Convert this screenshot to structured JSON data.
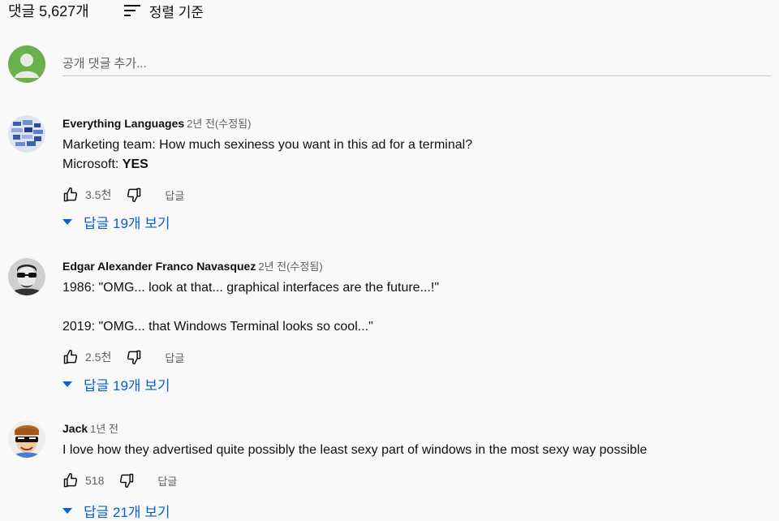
{
  "header": {
    "comment_count": "댓글 5,627개",
    "sort_label": "정렬 기준"
  },
  "add_comment": {
    "placeholder": "공개 댓글 추가..."
  },
  "comments": [
    {
      "author": "Everything Languages",
      "time": "2년 전(수정됨)",
      "line1": "Marketing team: How much sexiness you want in this ad for a terminal?",
      "line2_prefix": "Microsoft: ",
      "line2_bold": "YES",
      "likes": "3.5천",
      "reply_label": "답글",
      "replies_label": "답글 19개 보기"
    },
    {
      "author": "Edgar Alexander Franco Navasquez",
      "time": "2년 전(수정됨)",
      "line1": "1986: \"OMG... look at that... graphical interfaces are the future...!\"",
      "line2": "2019: \"OMG... that Windows Terminal looks so cool...\"",
      "likes": "2.5천",
      "reply_label": "답글",
      "replies_label": "답글 19개 보기"
    },
    {
      "author": "Jack",
      "time": "1년 전",
      "line1": "I love how they advertised quite possibly the least sexy part of windows in the most sexy way possible",
      "likes": "518",
      "reply_label": "답글",
      "replies_label": "답글 21개 보기"
    }
  ],
  "colors": {
    "link_blue": "#065fd4",
    "secondary_text": "#606060",
    "background": "#f9f9f9",
    "user_avatar": "#6ab04c"
  }
}
